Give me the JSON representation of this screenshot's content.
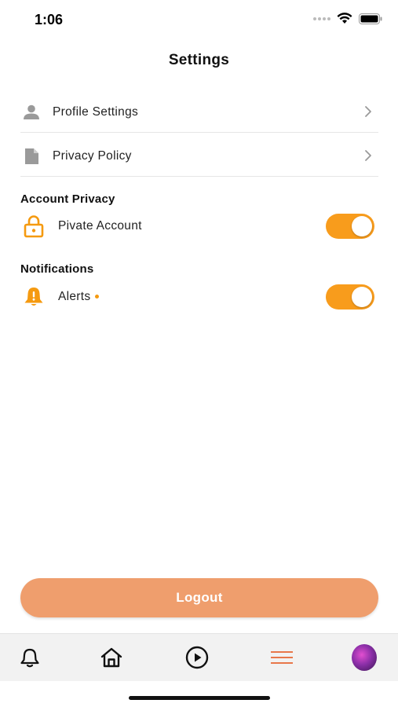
{
  "status_bar": {
    "time": "1:06"
  },
  "header": {
    "title": "Settings"
  },
  "menu": [
    {
      "label": "Profile Settings",
      "icon": "person-icon"
    },
    {
      "label": "Privacy Policy",
      "icon": "document-icon"
    }
  ],
  "account_privacy": {
    "title": "Account Privacy",
    "private_account": {
      "label": "Pivate Account",
      "enabled": true
    }
  },
  "notifications": {
    "title": "Notifications",
    "alerts": {
      "label": "Alerts",
      "enabled": true
    }
  },
  "logout": {
    "label": "Logout"
  },
  "tab_bar": {
    "items": [
      "bell-icon",
      "home-icon",
      "play-icon",
      "menu-icon",
      "avatar"
    ],
    "active": "menu-icon"
  },
  "colors": {
    "accent": "#f89c1c",
    "logout_bg": "#ef9e6d",
    "active_tab": "#e8774a"
  }
}
